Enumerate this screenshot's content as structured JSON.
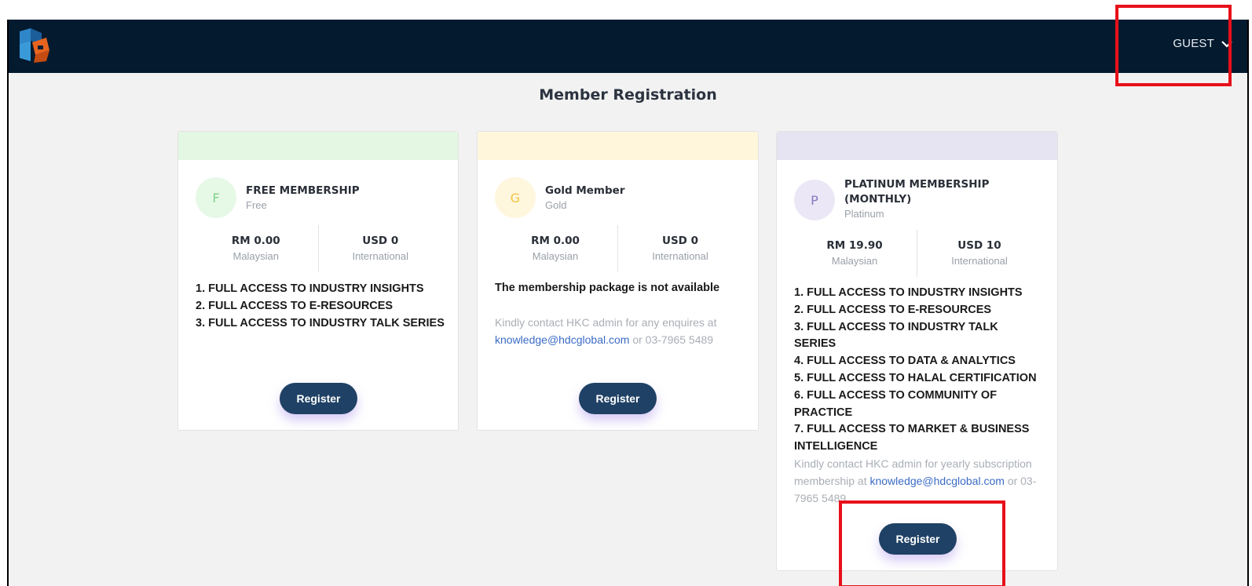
{
  "header": {
    "user_menu_label": "GUEST"
  },
  "page": {
    "title": "Member Registration"
  },
  "plans": [
    {
      "initial": "F",
      "name": "FREE MEMBERSHIP",
      "tier": "Free",
      "price_local": "RM 0.00",
      "price_local_label": "Malaysian",
      "price_intl": "USD 0",
      "price_intl_label": "International",
      "features": [
        "1.  FULL ACCESS TO INDUSTRY INSIGHTS",
        "2.  FULL ACCESS TO E-RESOURCES",
        "3.  FULL ACCESS TO INDUSTRY TALK SERIES"
      ],
      "register_label": "Register",
      "band_color": "#e3f7e3",
      "avatar_bg": "#e6f8e6",
      "avatar_fg": "#7fd28a"
    },
    {
      "initial": "G",
      "name": "Gold Member",
      "tier": "Gold",
      "price_local": "RM 0.00",
      "price_local_label": "Malaysian",
      "price_intl": "USD 0",
      "price_intl_label": "International",
      "unavailable": "The membership package is not available",
      "contact_prefix": "Kindly contact HKC admin for any enquires at",
      "contact_email": "knowledge@hdcglobal.com",
      "contact_suffix": "or 03-7965 5489",
      "register_label": "Register",
      "band_color": "#fff6dc",
      "avatar_bg": "#fff6de",
      "avatar_fg": "#f3c441"
    },
    {
      "initial": "P",
      "name": "PLATINUM MEMBERSHIP (MONTHLY)",
      "tier": "Platinum",
      "price_local": "RM 19.90",
      "price_local_label": "Malaysian",
      "price_intl": "USD 10",
      "price_intl_label": "International",
      "features": [
        "1.  FULL ACCESS TO INDUSTRY INSIGHTS",
        "2.  FULL ACCESS TO E-RESOURCES",
        "3.  FULL ACCESS TO INDUSTRY TALK SERIES",
        "4.  FULL ACCESS TO DATA & ANALYTICS",
        "5.  FULL ACCESS TO HALAL CERTIFICATION",
        "6.  FULL ACCESS TO COMMUNITY OF PRACTICE",
        "7.  FULL ACCESS TO MARKET & BUSINESS INTELLIGENCE"
      ],
      "contact_prefix": "Kindly contact HKC admin for yearly subscription membership at",
      "contact_email": "knowledge@hdcglobal.com",
      "contact_suffix": "or 03-7965 5489",
      "register_label": "Register",
      "band_color": "#e6e3f2",
      "avatar_bg": "#ebe7f6",
      "avatar_fg": "#8a77c2"
    }
  ],
  "colors": {
    "nav_bg": "#041a2e",
    "button_bg": "#1f4165",
    "highlight": "#e8101a",
    "link": "#3b6bc6"
  }
}
